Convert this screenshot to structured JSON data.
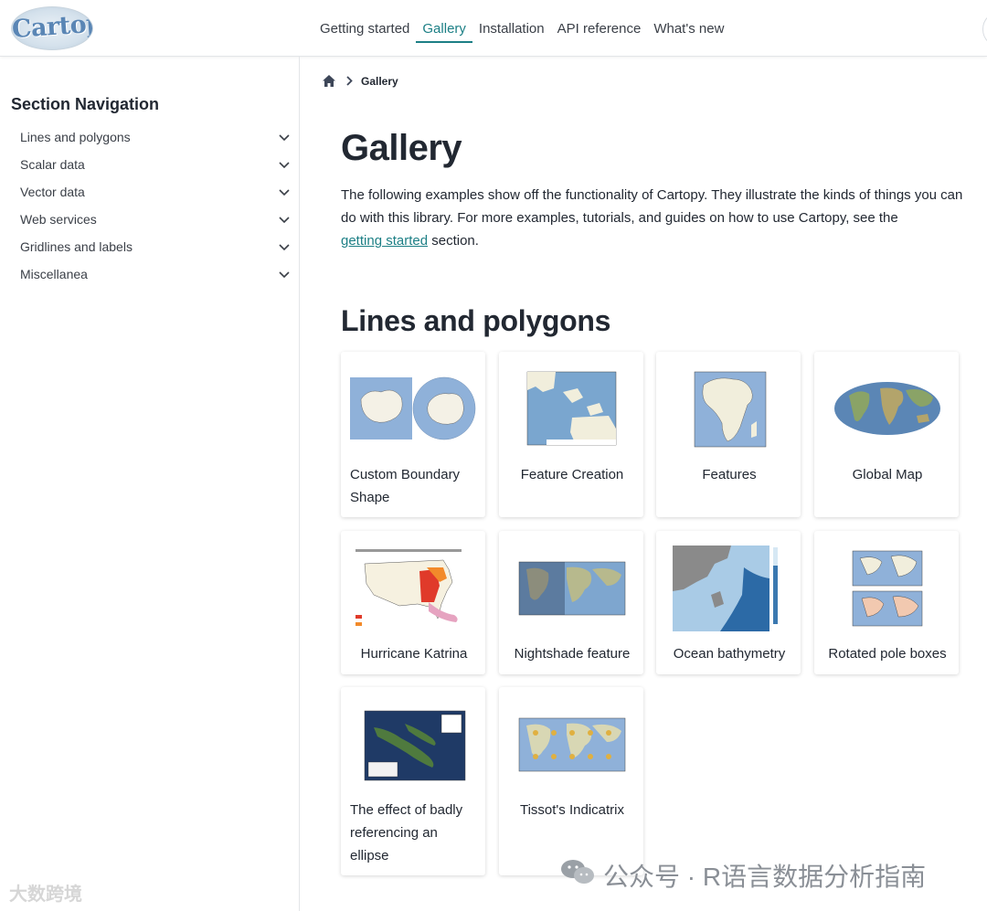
{
  "header": {
    "logo_text": "Cartopy",
    "nav": [
      {
        "label": "Getting started",
        "active": false
      },
      {
        "label": "Gallery",
        "active": true
      },
      {
        "label": "Installation",
        "active": false
      },
      {
        "label": "API reference",
        "active": false
      },
      {
        "label": "What's new",
        "active": false
      }
    ]
  },
  "sidebar": {
    "title": "Section Navigation",
    "items": [
      {
        "label": "Lines and polygons"
      },
      {
        "label": "Scalar data"
      },
      {
        "label": "Vector data"
      },
      {
        "label": "Web services"
      },
      {
        "label": "Gridlines and labels"
      },
      {
        "label": "Miscellanea"
      }
    ]
  },
  "breadcrumb": {
    "current": "Gallery"
  },
  "main": {
    "title": "Gallery",
    "intro_text": "The following examples show off the functionality of Cartopy. They illustrate the kinds of things you can do with this library. For more examples, tutorials, and guides on how to use Cartopy, see the",
    "intro_link": "getting started",
    "intro_end": "section.",
    "section_title": "Lines and polygons"
  },
  "gallery": [
    {
      "caption": "Custom Boundary Shape"
    },
    {
      "caption": "Feature Creation"
    },
    {
      "caption": "Features"
    },
    {
      "caption": "Global Map"
    },
    {
      "caption": "Hurricane Katrina"
    },
    {
      "caption": "Nightshade feature"
    },
    {
      "caption": "Ocean bathymetry"
    },
    {
      "caption": "Rotated pole boxes"
    },
    {
      "caption": "The effect of badly referencing an ellipse"
    },
    {
      "caption": "Tissot's Indicatrix"
    }
  ],
  "watermarks": {
    "left": "大数跨境",
    "right": "公众号 · R语言数据分析指南"
  },
  "colors": {
    "accent": "#1c7f85",
    "text": "#222832",
    "ocean": "#8fb1d9",
    "land": "#f1eedc"
  }
}
